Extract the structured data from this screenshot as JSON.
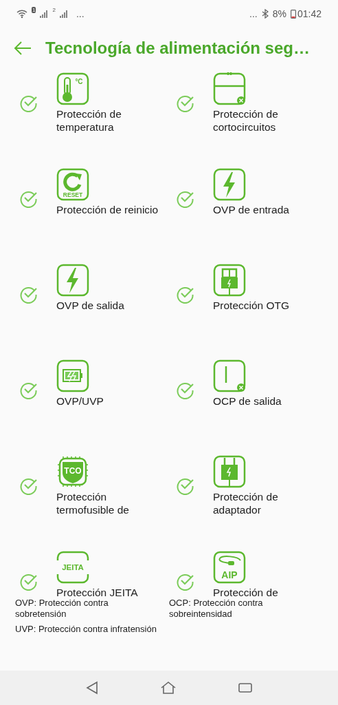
{
  "status_bar": {
    "sim_1": "1",
    "sim_2": "2",
    "left_more": "...",
    "right_more": "...",
    "battery_percent": "8%",
    "time": "01:42"
  },
  "header": {
    "title": "Tecnología de alimentación seg…"
  },
  "features": [
    {
      "kind": "thermometer",
      "icon_text": "°C",
      "label": "Protección de temperatura",
      "checked": true
    },
    {
      "kind": "short_circuit",
      "label": "Protección de cortocircuitos",
      "checked": true
    },
    {
      "kind": "reset",
      "icon_text": "RESET",
      "label": "Protección de reinicio",
      "checked": true
    },
    {
      "kind": "bolt",
      "label": "OVP de entrada",
      "checked": true
    },
    {
      "kind": "bolt",
      "label": "OVP de salida",
      "checked": true
    },
    {
      "kind": "otg",
      "label": "Protección OTG",
      "checked": true
    },
    {
      "kind": "battery",
      "label": "OVP/UVP",
      "checked": true
    },
    {
      "kind": "ocp",
      "label": "OCP de salida",
      "checked": true
    },
    {
      "kind": "tco",
      "icon_text": "TCO",
      "label": "Protección termofusible de",
      "checked": true
    },
    {
      "kind": "adapter",
      "label": "Protección de adaptador",
      "checked": true
    },
    {
      "kind": "jeita",
      "icon_text": "JEITA",
      "label": "Protección JEITA",
      "checked": true
    },
    {
      "kind": "aip",
      "icon_text": "AIP",
      "label": "Protección de",
      "checked": true
    }
  ],
  "notes": [
    "OVP: Protección contra sobretensión",
    "OCP: Protección contra sobreintensidad",
    "UVP: Protección contra infratensión"
  ]
}
